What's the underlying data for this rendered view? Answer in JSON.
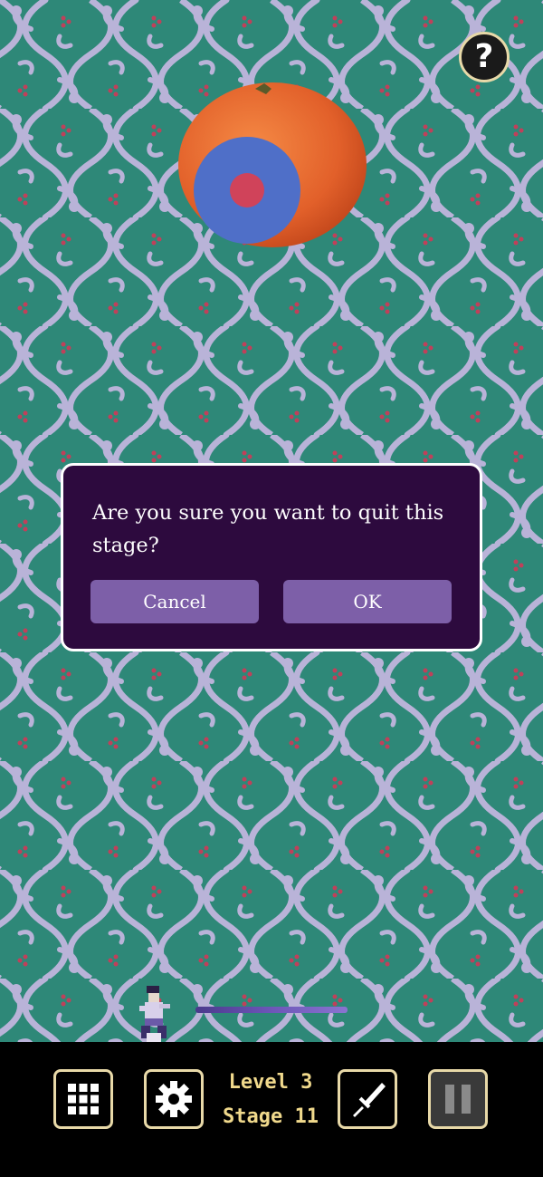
{
  "help": {
    "label": "?"
  },
  "dialog": {
    "message": "Are you sure you want to quit this stage?",
    "cancel_label": "Cancel",
    "ok_label": "OK"
  },
  "hud": {
    "level_label": "Level 3",
    "stage_label": "Stage 11"
  },
  "icons": {
    "menu": "grid-icon",
    "settings": "gear-icon",
    "weapon": "sword-icon",
    "pause": "pause-icon",
    "help": "question-icon"
  },
  "colors": {
    "background": "#2e8878",
    "vine": "#b9b3d8",
    "berry": "#c0405a",
    "dialog_bg": "#2d0a3e",
    "dialog_button": "#7d5fa8",
    "hud_text": "#f0d98c",
    "button_border": "#e8d9a8",
    "target_outer": "#4f6fc8",
    "target_inner": "#d0435a",
    "orange": "#e8682a"
  }
}
